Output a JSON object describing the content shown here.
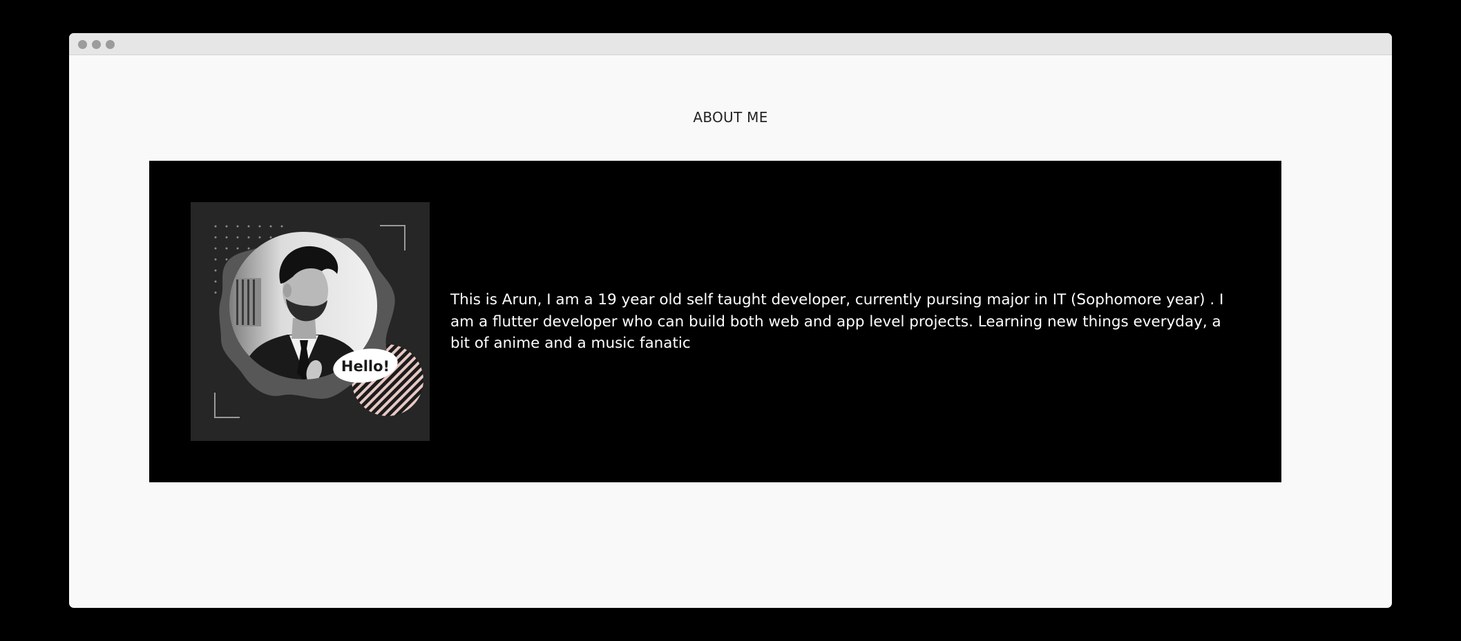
{
  "window": {
    "traffic_lights": [
      "close",
      "minimize",
      "zoom"
    ],
    "chrome_color": "#e6e6e6"
  },
  "about": {
    "heading": "ABOUT ME",
    "bio": "This is Arun, I am a 19 year old self taught developer, currently pursing major in IT (Sophomore year) . I am a flutter developer who can build both web and app level projects. Learning new things everyday, a bit of anime and a music fanatic",
    "photo": {
      "badge_text": "Hello!",
      "accent_stripe_color": "#e8c8c4"
    }
  },
  "colors": {
    "page_background": "#000000",
    "window_background": "#f9f9f9",
    "card_background": "#000000",
    "photo_background": "#262626",
    "heading_color": "#222222",
    "bio_color": "#ffffff"
  }
}
